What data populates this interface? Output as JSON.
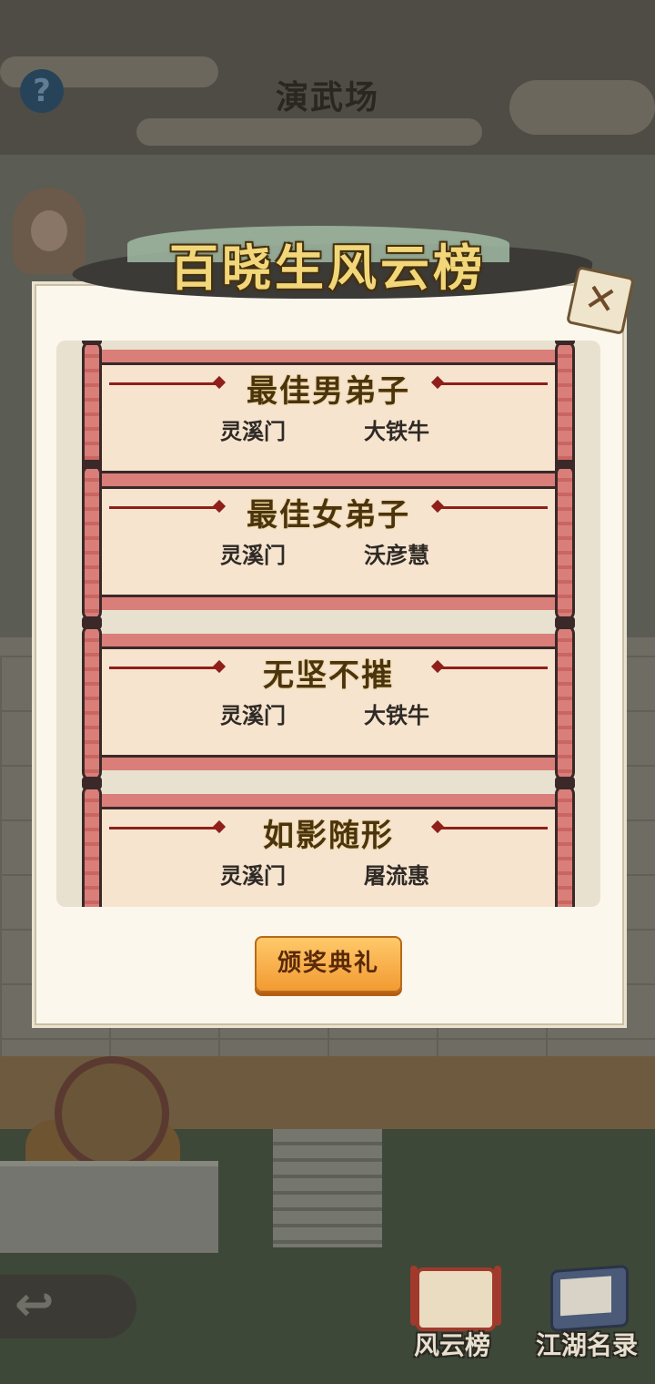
{
  "header": {
    "title": "演武场",
    "help_icon": "question-mark-icon",
    "help_glyph": "?"
  },
  "dialog": {
    "title": "百晓生风云榜",
    "close_glyph": "✕",
    "awards": [
      {
        "award": "最佳男弟子",
        "sect": "灵溪门",
        "winner": "大铁牛"
      },
      {
        "award": "最佳女弟子",
        "sect": "灵溪门",
        "winner": "沃彦慧"
      },
      {
        "award": "无坚不摧",
        "sect": "灵溪门",
        "winner": "大铁牛"
      },
      {
        "award": "如影随形",
        "sect": "灵溪门",
        "winner": "屠流惠"
      }
    ],
    "ceremony_button": "颁奖典礼"
  },
  "footer": {
    "back_glyph": "↩",
    "nav": [
      {
        "label": "风云榜",
        "icon": "scroll-icon"
      },
      {
        "label": "江湖名录",
        "icon": "book-icon"
      }
    ]
  },
  "colors": {
    "accent": "#f29a32",
    "scroll_red": "#d97e79",
    "title_gold": "#f2d77a"
  }
}
